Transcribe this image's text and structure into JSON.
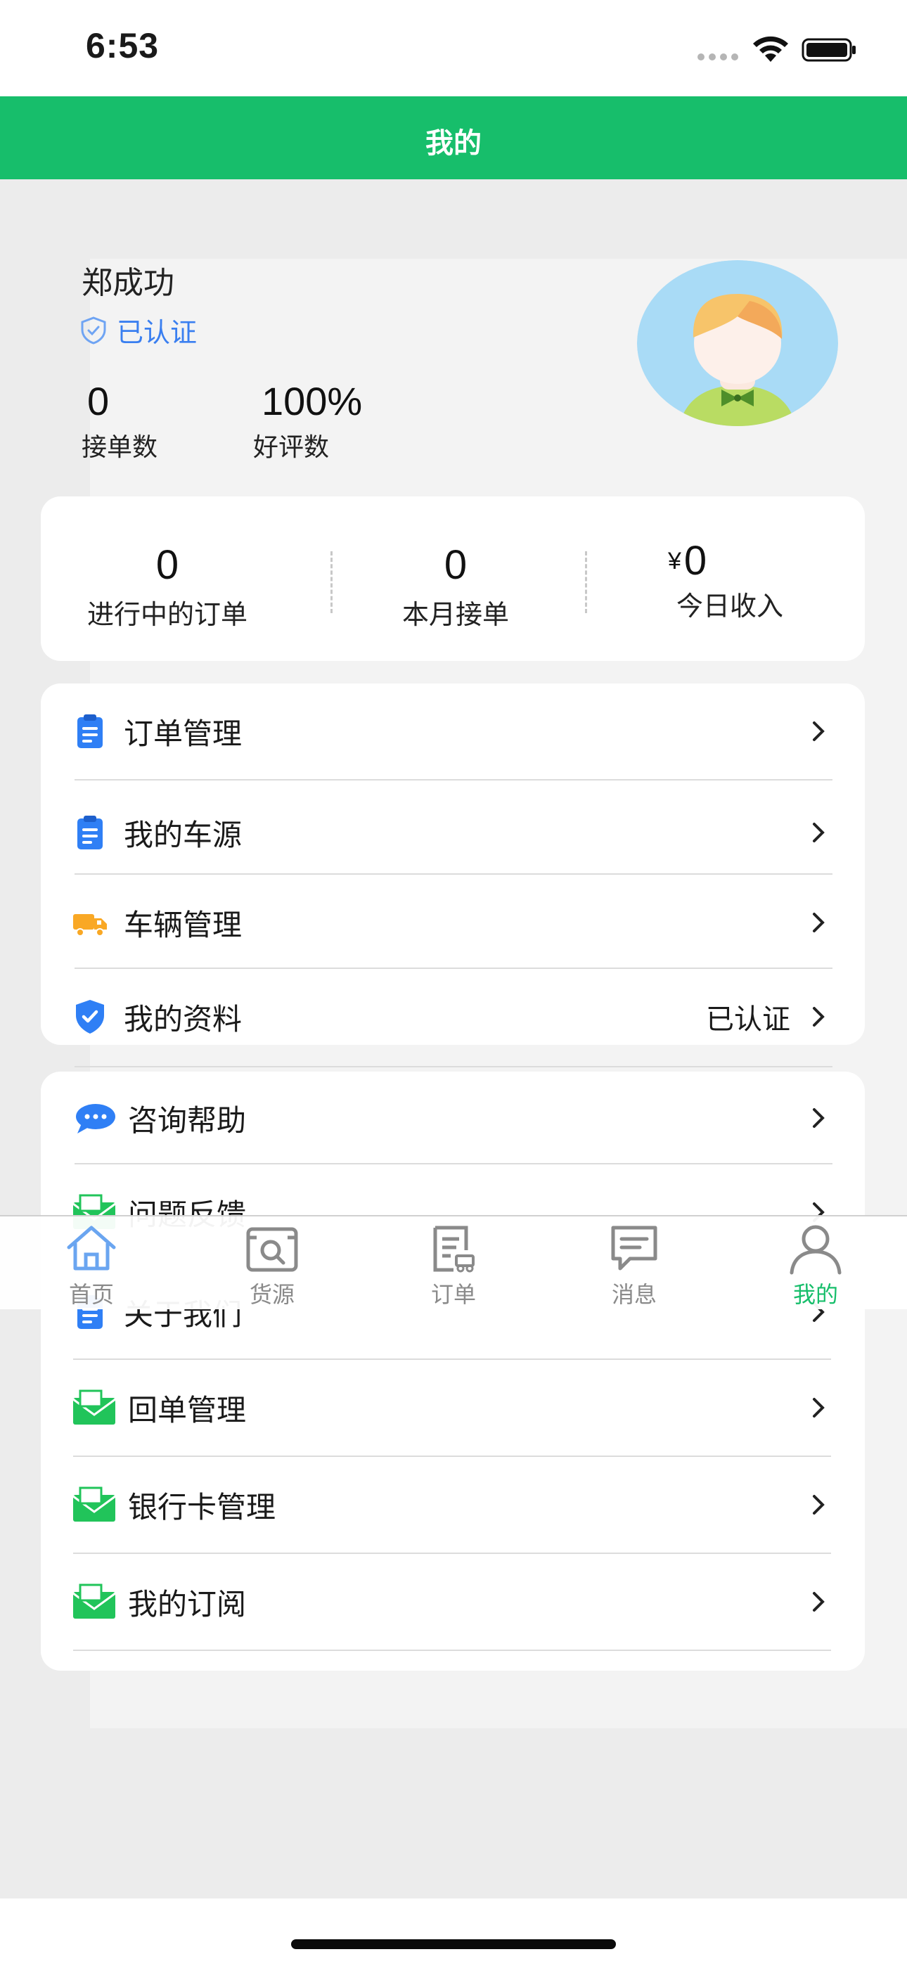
{
  "status_bar": {
    "time": "6:53"
  },
  "nav": {
    "title": "我的"
  },
  "profile": {
    "name": "郑成功",
    "verified_label": "已认证",
    "stats": [
      {
        "value": "0",
        "label": "接单数"
      },
      {
        "value": "100%",
        "label": "好评数"
      }
    ]
  },
  "summary": {
    "in_progress": {
      "value": "0",
      "label": "进行中的订单"
    },
    "month_orders": {
      "value": "0",
      "label": "本月接单"
    },
    "today_income": {
      "currency": "¥",
      "value": "0",
      "label": "今日收入"
    }
  },
  "menu_group_1": [
    {
      "label": "订单管理",
      "icon": "clipboard-icon"
    },
    {
      "label": "我的车源",
      "icon": "clipboard-icon"
    },
    {
      "label": "车辆管理",
      "icon": "truck-icon"
    },
    {
      "label": "我的资料",
      "icon": "shield-check-icon",
      "extra": "已认证"
    }
  ],
  "menu_group_2": [
    {
      "label": "咨询帮助",
      "icon": "chat-bubble-icon"
    },
    {
      "label": "问题反馈",
      "icon": "envelope-icon"
    },
    {
      "label": "关于我们",
      "icon": "clipboard-icon"
    },
    {
      "label": "回单管理",
      "icon": "envelope-icon"
    },
    {
      "label": "银行卡管理",
      "icon": "envelope-icon"
    },
    {
      "label": "我的订阅",
      "icon": "envelope-icon"
    }
  ],
  "tab_bar": {
    "tabs": [
      {
        "label": "首页",
        "icon": "home-icon"
      },
      {
        "label": "货源",
        "icon": "cargo-search-icon"
      },
      {
        "label": "订单",
        "icon": "order-icon"
      },
      {
        "label": "消息",
        "icon": "message-icon"
      },
      {
        "label": "我的",
        "icon": "user-icon",
        "active": true
      }
    ]
  },
  "colors": {
    "accent": "#17be6b",
    "link_blue": "#3a7ff0",
    "icon_blue": "#2f7ff5",
    "icon_orange": "#f9a825",
    "icon_green": "#21c45a"
  }
}
